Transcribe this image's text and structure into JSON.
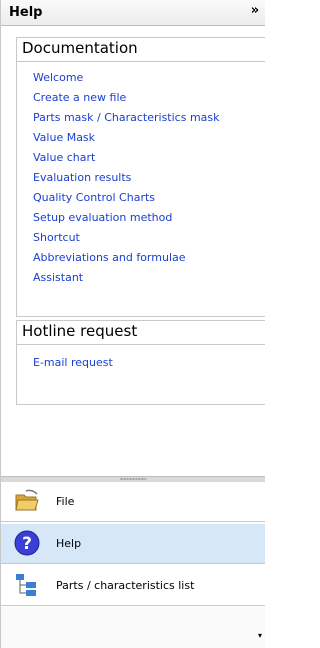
{
  "header": {
    "title": "Help",
    "collapse_glyph": "»"
  },
  "documentation": {
    "title": "Documentation",
    "links": [
      "Welcome",
      "Create a new file",
      "Parts mask / Characteristics mask",
      "Value Mask",
      "Value chart",
      "Evaluation results",
      "Quality Control Charts",
      "Setup evaluation method",
      "Shortcut",
      "Abbreviations and formulae",
      "Assistant"
    ]
  },
  "hotline": {
    "title": "Hotline request",
    "links": [
      "E-mail request"
    ]
  },
  "nav": {
    "items": [
      {
        "label": "File",
        "icon": "folder-icon"
      },
      {
        "label": "Help",
        "icon": "help-icon",
        "active": true
      },
      {
        "label": "Parts / characteristics list",
        "icon": "tree-list-icon"
      }
    ],
    "overflow_glyph": "▾"
  },
  "colors": {
    "link": "#1a3fd0",
    "active_item": "#d6e8f7",
    "help_icon": "#3a3fd6",
    "folder": "#e8b84a"
  }
}
